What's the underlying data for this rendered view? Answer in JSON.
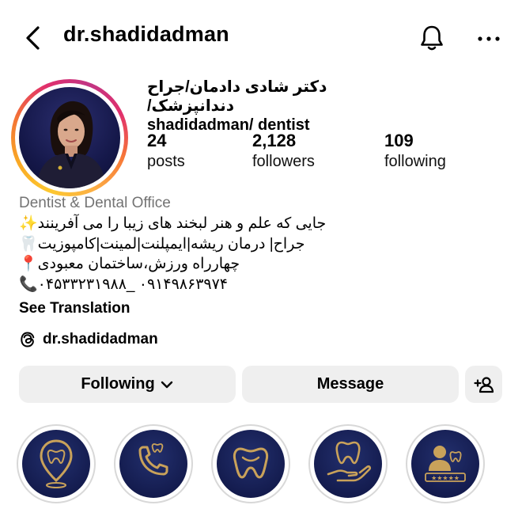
{
  "header": {
    "username": "dr.shadidadman"
  },
  "profile": {
    "full_name_line1": "دکتر شادی دادمان/جراح دندانپزشک/",
    "full_name_line2": "shadidadman/ dentist",
    "stats": [
      {
        "value": "24",
        "label": "posts"
      },
      {
        "value": "2,128",
        "label": "followers"
      },
      {
        "value": "109",
        "label": "following"
      }
    ],
    "category": "Dentist & Dental Office",
    "bio_lines": [
      "✨جایی که علم و هنر لبخند های زیبا را می آفرینند",
      "🦷جراح| درمان ریشه|ایمپلنت|لمینت|کامپوزیت",
      "📍چهارراه ورزش،ساختمان معبودی",
      "📞۰۴۵۳۳۲۳۱۹۸۸_ ۰۹۱۴۹۸۶۳۹۷۴"
    ],
    "see_translation": "See Translation",
    "threads_handle": "dr.shadidadman"
  },
  "actions": {
    "following_label": "Following",
    "message_label": "Message"
  },
  "highlights": [
    {
      "icon": "tooth-location-icon"
    },
    {
      "icon": "tooth-phone-icon"
    },
    {
      "icon": "tooth-smile-icon"
    },
    {
      "icon": "tooth-hand-icon"
    },
    {
      "icon": "tooth-review-icon"
    }
  ],
  "colors": {
    "highlight_bg": "#141c4f",
    "highlight_gold": "#c9a25a",
    "button_bg": "#efefef",
    "category_gray": "#737373"
  }
}
